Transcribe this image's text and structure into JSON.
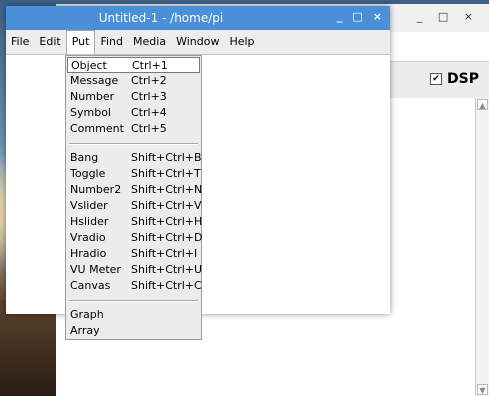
{
  "front_window": {
    "title": "Untitled-1  - /home/pi",
    "controls": [
      "_",
      "□",
      "×"
    ]
  },
  "back_window": {
    "controls": [
      "_",
      "□",
      "×"
    ],
    "dsp_label": "DSP",
    "dsp_checked": true,
    "scroll_up": "▲",
    "scroll_down": "▼"
  },
  "menubar": [
    "File",
    "Edit",
    "Put",
    "Find",
    "Media",
    "Window",
    "Help"
  ],
  "put_menu": {
    "group1": [
      {
        "label": "Object",
        "accel": "Ctrl+1"
      },
      {
        "label": "Message",
        "accel": "Ctrl+2"
      },
      {
        "label": "Number",
        "accel": "Ctrl+3"
      },
      {
        "label": "Symbol",
        "accel": "Ctrl+4"
      },
      {
        "label": "Comment",
        "accel": "Ctrl+5"
      }
    ],
    "group2": [
      {
        "label": "Bang",
        "accel": "Shift+Ctrl+B"
      },
      {
        "label": "Toggle",
        "accel": "Shift+Ctrl+T"
      },
      {
        "label": "Number2",
        "accel": "Shift+Ctrl+N"
      },
      {
        "label": "Vslider",
        "accel": "Shift+Ctrl+V"
      },
      {
        "label": "Hslider",
        "accel": "Shift+Ctrl+H"
      },
      {
        "label": "Vradio",
        "accel": "Shift+Ctrl+D"
      },
      {
        "label": "Hradio",
        "accel": "Shift+Ctrl+I"
      },
      {
        "label": "VU Meter",
        "accel": "Shift+Ctrl+U"
      },
      {
        "label": "Canvas",
        "accel": "Shift+Ctrl+C"
      }
    ],
    "group3": [
      {
        "label": "Graph",
        "accel": ""
      },
      {
        "label": "Array",
        "accel": ""
      }
    ]
  },
  "colors": {
    "titlebar": "#4a90d9",
    "menu_bg": "#ececec"
  }
}
